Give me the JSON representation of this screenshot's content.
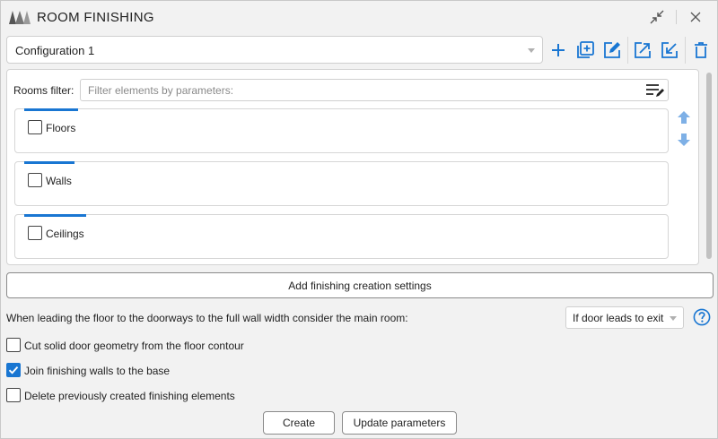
{
  "window": {
    "title": "ROOM FINISHING",
    "logo_icon": "brand-logo-icon",
    "accent_color": "#1976d2"
  },
  "config": {
    "selected": "Configuration 1",
    "actions": [
      "add-icon",
      "duplicate-icon",
      "edit-icon",
      "export-icon",
      "import-icon",
      "delete-icon"
    ]
  },
  "filter": {
    "label": "Rooms filter:",
    "placeholder": "Filter elements by parameters:",
    "icon": "filter-edit-icon"
  },
  "categories": [
    {
      "label": "Floors",
      "checked": false
    },
    {
      "label": "Walls",
      "checked": false
    },
    {
      "label": "Ceilings",
      "checked": false
    }
  ],
  "add_settings_label": "Add finishing creation settings",
  "doorway": {
    "label": "When leading the floor to the doorways to the full wall width consider the main room:",
    "selected": "If door leads to exit"
  },
  "options": [
    {
      "label": "Cut solid door geometry from the floor contour",
      "checked": false
    },
    {
      "label": "Join finishing walls to the base",
      "checked": true
    },
    {
      "label": "Delete previously created finishing elements",
      "checked": false
    }
  ],
  "buttons": {
    "create": "Create",
    "update": "Update parameters"
  }
}
